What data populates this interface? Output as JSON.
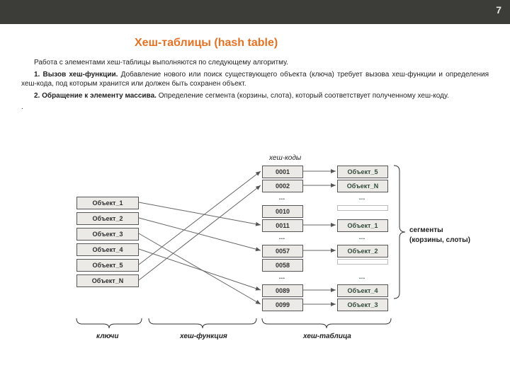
{
  "pagenum": "7",
  "title": "Хеш-таблицы (hash table)",
  "para1": "Работа с элементами хеш-таблицы выполняются по  следующему алгоритму.",
  "step1_lead": "1. Вызов хеш-функции. ",
  "step1_rest": "Добавление нового или поиск существующего объекта (ключа) требует вызова хеш-функции и определения хеш-кода, под которым хранится или должен быть сохранен объект.",
  "step2_lead": "2. Обращение к элементу массива. ",
  "step2_rest": "Определение сегмента (корзины, слота), который соответствует полученному хеш-коду.",
  "period": ".",
  "keys": [
    "Объект_1",
    "Объект_2",
    "Объект_3",
    "Объект_4",
    "Объект_5",
    "Объект_N"
  ],
  "hash_label": "хеш-коды",
  "codes": [
    "0001",
    "0002",
    "…",
    "0010",
    "0011",
    "…",
    "0057",
    "0058",
    "…",
    "0089",
    "0099"
  ],
  "objects": [
    "Объект_5",
    "Объект_N",
    "…",
    "",
    "Объект_1",
    "…",
    "Объект_2",
    "",
    "…",
    "Объект_4",
    "Объект_3"
  ],
  "segments_line1": "сегменты",
  "segments_line2": "(корзины, слоты)",
  "bottom_keys": "ключи",
  "bottom_fn": "хеш-функция",
  "bottom_table": "хеш-таблица"
}
